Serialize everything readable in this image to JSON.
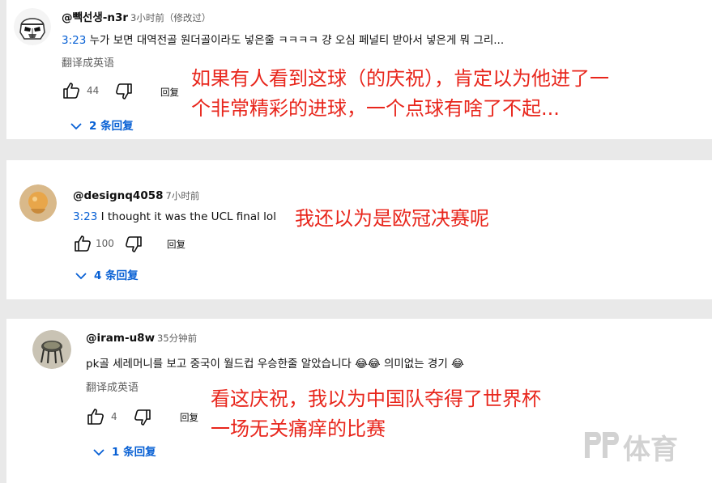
{
  "comments": [
    {
      "handle": "@빽선생-n3r",
      "time": "3小时前（修改过）",
      "timestamp_link": "3:23",
      "text": " 누가 보면 대역전골 원더골이라도 넣은줄 ㅋㅋㅋㅋ 걍 오심 페널티 받아서 넣은게 뭐 그리...",
      "translate_label": "翻译成英语",
      "likes": "44",
      "reply_label": "回复",
      "replies_label": "2 条回复",
      "annotation_lines": [
        "如果有人看到这球（的庆祝），肯定以为他进了一",
        "个非常精彩的进球，一个点球有啥了不起..."
      ]
    },
    {
      "handle": "@designq4058",
      "time": "7小时前",
      "timestamp_link": "3:23",
      "text": " I thought it was the UCL final lol",
      "likes": "100",
      "reply_label": "回复",
      "replies_label": "4 条回复",
      "annotation_lines": [
        "我还以为是欧冠决赛呢"
      ]
    },
    {
      "handle": "@iram-u8w",
      "time": "35分钟前",
      "text_part1": "pk골 세레머니를 보고 중국이 월드컵 우승한줄 알았습니다",
      "emoji_1": "😂😂",
      "text_part2": " 의미없는 경기",
      "emoji_2": "😂",
      "translate_label": "翻译成英语",
      "likes": "4",
      "reply_label": "回复",
      "replies_label": "1 条回复",
      "annotation_lines": [
        "看这庆祝，我以为中国队夺得了世界杯",
        "一场无关痛痒的比赛"
      ]
    }
  ],
  "watermark": {
    "logo_text": "PP",
    "label": "体育"
  },
  "colors": {
    "link": "#065fd4",
    "annotation": "#e8261c",
    "meta": "#606060"
  },
  "icons": [
    "stormtrooper-avatar",
    "orange-avatar",
    "chair-avatar",
    "thumbs-up-icon",
    "thumbs-down-icon",
    "chevron-down-icon"
  ]
}
